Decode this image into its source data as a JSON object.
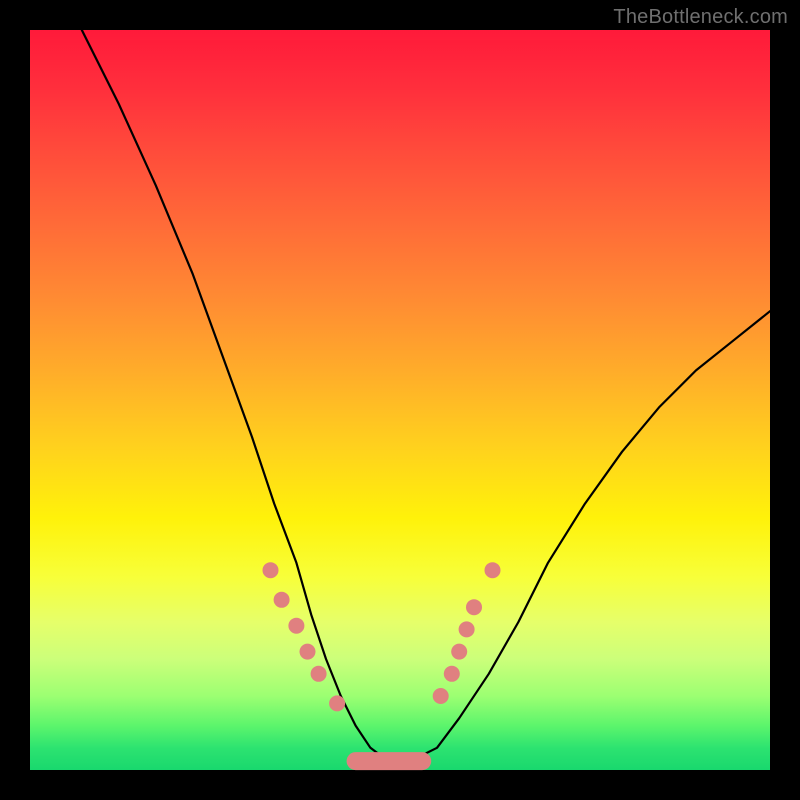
{
  "watermark": "TheBottleneck.com",
  "colors": {
    "marker": "#e08080",
    "curve": "#000000",
    "frame": "#000000"
  },
  "chart_data": {
    "type": "line",
    "title": "",
    "xlabel": "",
    "ylabel": "",
    "xlim": [
      0,
      100
    ],
    "ylim": [
      0,
      100
    ],
    "grid": false,
    "legend": false,
    "series": [
      {
        "name": "bottleneck-curve",
        "x": [
          7,
          12,
          17,
          22,
          26,
          30,
          33,
          36,
          38,
          40,
          42,
          44,
          46,
          48,
          50,
          52,
          55,
          58,
          62,
          66,
          70,
          75,
          80,
          85,
          90,
          95,
          100
        ],
        "y": [
          100,
          90,
          79,
          67,
          56,
          45,
          36,
          28,
          21,
          15,
          10,
          6,
          3,
          1.5,
          1,
          1.5,
          3,
          7,
          13,
          20,
          28,
          36,
          43,
          49,
          54,
          58,
          62
        ]
      }
    ],
    "markers": {
      "left_branch": [
        {
          "x": 32.5,
          "y": 27
        },
        {
          "x": 34.0,
          "y": 23
        },
        {
          "x": 36.0,
          "y": 19.5
        },
        {
          "x": 37.5,
          "y": 16
        },
        {
          "x": 39.0,
          "y": 13
        },
        {
          "x": 41.5,
          "y": 9
        }
      ],
      "right_branch": [
        {
          "x": 55.5,
          "y": 10
        },
        {
          "x": 57.0,
          "y": 13
        },
        {
          "x": 58.0,
          "y": 16
        },
        {
          "x": 59.0,
          "y": 19
        },
        {
          "x": 60.0,
          "y": 22
        },
        {
          "x": 62.5,
          "y": 27
        }
      ],
      "bottom_segment": {
        "x_start": 44,
        "x_end": 53,
        "y": 1.2
      }
    }
  }
}
